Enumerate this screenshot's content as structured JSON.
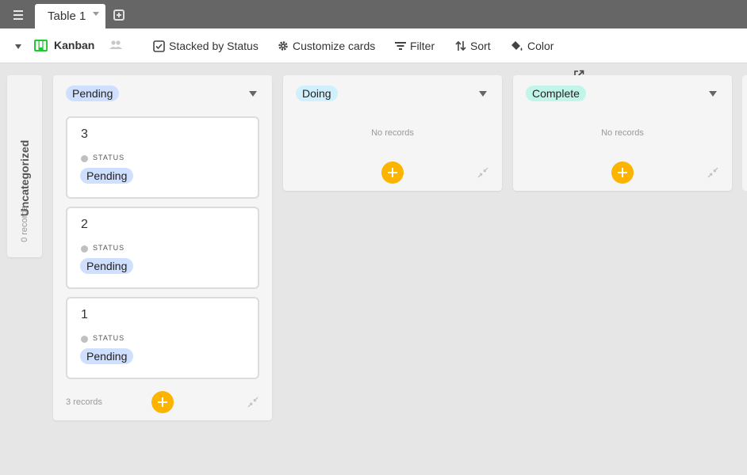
{
  "tabbar": {
    "tabs": [
      {
        "label": "Table 1"
      }
    ]
  },
  "toolbar": {
    "view_name": "Kanban",
    "stacked_by": "Stacked by Status",
    "customize_cards": "Customize cards",
    "filter": "Filter",
    "sort": "Sort",
    "color": "Color"
  },
  "uncategorized": {
    "title": "Uncategorized",
    "count": "0 records"
  },
  "stacks": [
    {
      "name": "Pending",
      "color": "#cfdfff",
      "cards": [
        {
          "title": "3",
          "field_label": "STATUS",
          "status": "Pending"
        },
        {
          "title": "2",
          "field_label": "STATUS",
          "status": "Pending"
        },
        {
          "title": "1",
          "field_label": "STATUS",
          "status": "Pending"
        }
      ],
      "footer_count": "3 records"
    },
    {
      "name": "Doing",
      "color": "#d0f0fd",
      "empty_text": "No records"
    },
    {
      "name": "Complete",
      "color": "#c2f5e9",
      "empty_text": "No records"
    }
  ],
  "colors": {
    "tabbar": "#666666",
    "add_button": "#fcb400",
    "kanban_icon": "#20c933"
  }
}
